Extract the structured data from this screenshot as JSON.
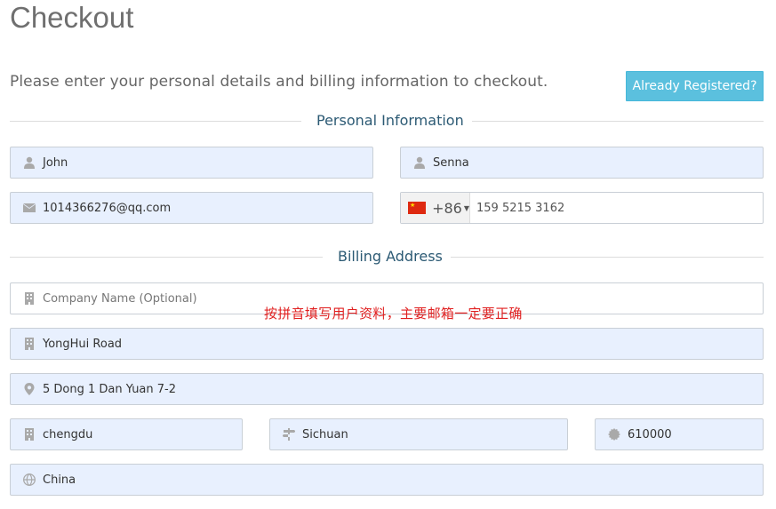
{
  "page": {
    "title": "Checkout",
    "intro": "Please enter your personal details and billing information to checkout.",
    "already_registered_label": "Already Registered?"
  },
  "sections": {
    "personal": "Personal Information",
    "billing": "Billing Address"
  },
  "personal": {
    "first_name": "John",
    "last_name": "Senna",
    "email": "1014366276@qq.com",
    "phone_dial_code": "+86",
    "phone_number": "159 5215 3162",
    "phone_flag": "china-flag-icon"
  },
  "billing": {
    "company_placeholder": "Company Name (Optional)",
    "address1": "YongHui Road",
    "address2": "5 Dong 1 Dan Yuan 7-2",
    "city": "chengdu",
    "state": "Sichuan",
    "postcode": "610000",
    "country": "China"
  },
  "annotation": "按拼音填写用户资料，主要邮箱一定要正确",
  "colors": {
    "accent_button": "#5bc0de",
    "section_heading": "#2c5a74",
    "autofill_bg": "#e8f0fe",
    "annotation_red": "#e02020"
  }
}
